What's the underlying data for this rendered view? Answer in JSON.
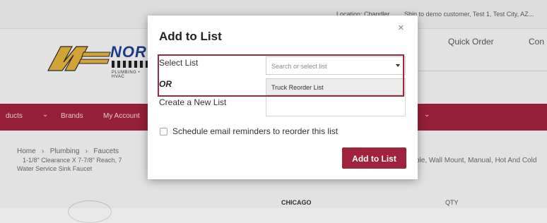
{
  "background": {
    "topbar": {
      "location": "Location: Chandler",
      "ship_to": "Ship to demo customer, Test 1, Test City, AZ..."
    },
    "logo": {
      "brand": "NORT",
      "tagline": "PLUMBING • HVAC"
    },
    "header": {
      "quick_order": "Quick Order",
      "contact": "Con"
    },
    "nav": {
      "products": "ducts",
      "brands": "Brands",
      "my_account": "My Account"
    },
    "breadcrumb": {
      "home": "Home",
      "plumbing": "Plumbing",
      "faucets": "Faucets",
      "line2": "1-1/8\" Clearance X 7-7/8\" Reach, 7",
      "line3": "Water Service Sink Faucet",
      "title_right": "ble, Wall Mount, Manual, Hot And Cold"
    },
    "product": {
      "brand_logo": "CHICAGO",
      "qty_label": "QTY"
    }
  },
  "modal": {
    "title": "Add to List",
    "close_glyph": "×",
    "select_list_label": "Select List",
    "select_placeholder": "Search or select list",
    "selected_option": "Truck Reorder List",
    "or_label": "OR",
    "create_new_label": "Create a New List",
    "schedule_label": "Schedule email reminders to reorder this list",
    "schedule_checked": false,
    "submit_label": "Add to List"
  },
  "colors": {
    "brand_red": "#a1223c",
    "logo_blue": "#1d3f8f",
    "logo_yellow": "#e2b03a"
  }
}
